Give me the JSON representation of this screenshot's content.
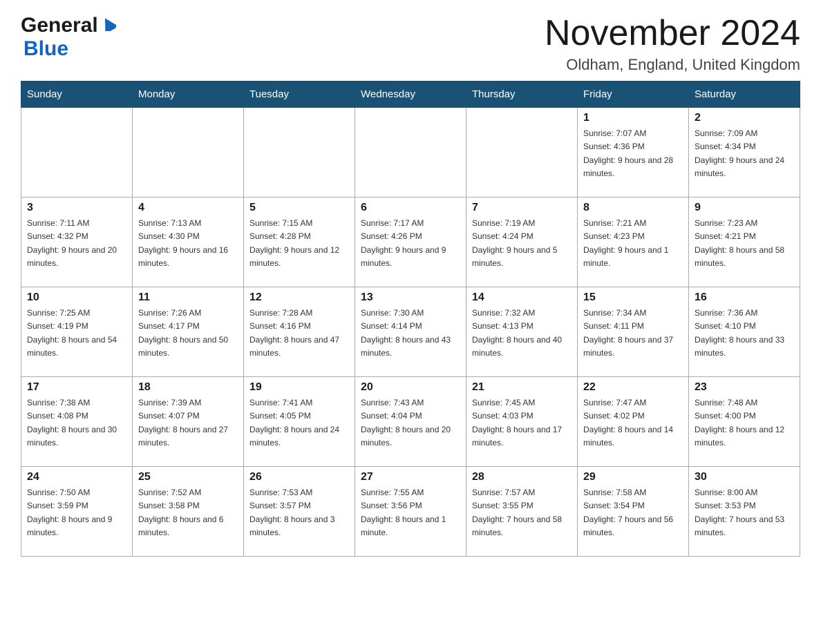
{
  "header": {
    "logo_text1": "General",
    "logo_text2": "Blue",
    "month_year": "November 2024",
    "location": "Oldham, England, United Kingdom"
  },
  "weekdays": [
    "Sunday",
    "Monday",
    "Tuesday",
    "Wednesday",
    "Thursday",
    "Friday",
    "Saturday"
  ],
  "weeks": [
    [
      {
        "day": "",
        "info": ""
      },
      {
        "day": "",
        "info": ""
      },
      {
        "day": "",
        "info": ""
      },
      {
        "day": "",
        "info": ""
      },
      {
        "day": "",
        "info": ""
      },
      {
        "day": "1",
        "info": "Sunrise: 7:07 AM\nSunset: 4:36 PM\nDaylight: 9 hours and 28 minutes."
      },
      {
        "day": "2",
        "info": "Sunrise: 7:09 AM\nSunset: 4:34 PM\nDaylight: 9 hours and 24 minutes."
      }
    ],
    [
      {
        "day": "3",
        "info": "Sunrise: 7:11 AM\nSunset: 4:32 PM\nDaylight: 9 hours and 20 minutes."
      },
      {
        "day": "4",
        "info": "Sunrise: 7:13 AM\nSunset: 4:30 PM\nDaylight: 9 hours and 16 minutes."
      },
      {
        "day": "5",
        "info": "Sunrise: 7:15 AM\nSunset: 4:28 PM\nDaylight: 9 hours and 12 minutes."
      },
      {
        "day": "6",
        "info": "Sunrise: 7:17 AM\nSunset: 4:26 PM\nDaylight: 9 hours and 9 minutes."
      },
      {
        "day": "7",
        "info": "Sunrise: 7:19 AM\nSunset: 4:24 PM\nDaylight: 9 hours and 5 minutes."
      },
      {
        "day": "8",
        "info": "Sunrise: 7:21 AM\nSunset: 4:23 PM\nDaylight: 9 hours and 1 minute."
      },
      {
        "day": "9",
        "info": "Sunrise: 7:23 AM\nSunset: 4:21 PM\nDaylight: 8 hours and 58 minutes."
      }
    ],
    [
      {
        "day": "10",
        "info": "Sunrise: 7:25 AM\nSunset: 4:19 PM\nDaylight: 8 hours and 54 minutes."
      },
      {
        "day": "11",
        "info": "Sunrise: 7:26 AM\nSunset: 4:17 PM\nDaylight: 8 hours and 50 minutes."
      },
      {
        "day": "12",
        "info": "Sunrise: 7:28 AM\nSunset: 4:16 PM\nDaylight: 8 hours and 47 minutes."
      },
      {
        "day": "13",
        "info": "Sunrise: 7:30 AM\nSunset: 4:14 PM\nDaylight: 8 hours and 43 minutes."
      },
      {
        "day": "14",
        "info": "Sunrise: 7:32 AM\nSunset: 4:13 PM\nDaylight: 8 hours and 40 minutes."
      },
      {
        "day": "15",
        "info": "Sunrise: 7:34 AM\nSunset: 4:11 PM\nDaylight: 8 hours and 37 minutes."
      },
      {
        "day": "16",
        "info": "Sunrise: 7:36 AM\nSunset: 4:10 PM\nDaylight: 8 hours and 33 minutes."
      }
    ],
    [
      {
        "day": "17",
        "info": "Sunrise: 7:38 AM\nSunset: 4:08 PM\nDaylight: 8 hours and 30 minutes."
      },
      {
        "day": "18",
        "info": "Sunrise: 7:39 AM\nSunset: 4:07 PM\nDaylight: 8 hours and 27 minutes."
      },
      {
        "day": "19",
        "info": "Sunrise: 7:41 AM\nSunset: 4:05 PM\nDaylight: 8 hours and 24 minutes."
      },
      {
        "day": "20",
        "info": "Sunrise: 7:43 AM\nSunset: 4:04 PM\nDaylight: 8 hours and 20 minutes."
      },
      {
        "day": "21",
        "info": "Sunrise: 7:45 AM\nSunset: 4:03 PM\nDaylight: 8 hours and 17 minutes."
      },
      {
        "day": "22",
        "info": "Sunrise: 7:47 AM\nSunset: 4:02 PM\nDaylight: 8 hours and 14 minutes."
      },
      {
        "day": "23",
        "info": "Sunrise: 7:48 AM\nSunset: 4:00 PM\nDaylight: 8 hours and 12 minutes."
      }
    ],
    [
      {
        "day": "24",
        "info": "Sunrise: 7:50 AM\nSunset: 3:59 PM\nDaylight: 8 hours and 9 minutes."
      },
      {
        "day": "25",
        "info": "Sunrise: 7:52 AM\nSunset: 3:58 PM\nDaylight: 8 hours and 6 minutes."
      },
      {
        "day": "26",
        "info": "Sunrise: 7:53 AM\nSunset: 3:57 PM\nDaylight: 8 hours and 3 minutes."
      },
      {
        "day": "27",
        "info": "Sunrise: 7:55 AM\nSunset: 3:56 PM\nDaylight: 8 hours and 1 minute."
      },
      {
        "day": "28",
        "info": "Sunrise: 7:57 AM\nSunset: 3:55 PM\nDaylight: 7 hours and 58 minutes."
      },
      {
        "day": "29",
        "info": "Sunrise: 7:58 AM\nSunset: 3:54 PM\nDaylight: 7 hours and 56 minutes."
      },
      {
        "day": "30",
        "info": "Sunrise: 8:00 AM\nSunset: 3:53 PM\nDaylight: 7 hours and 53 minutes."
      }
    ]
  ]
}
